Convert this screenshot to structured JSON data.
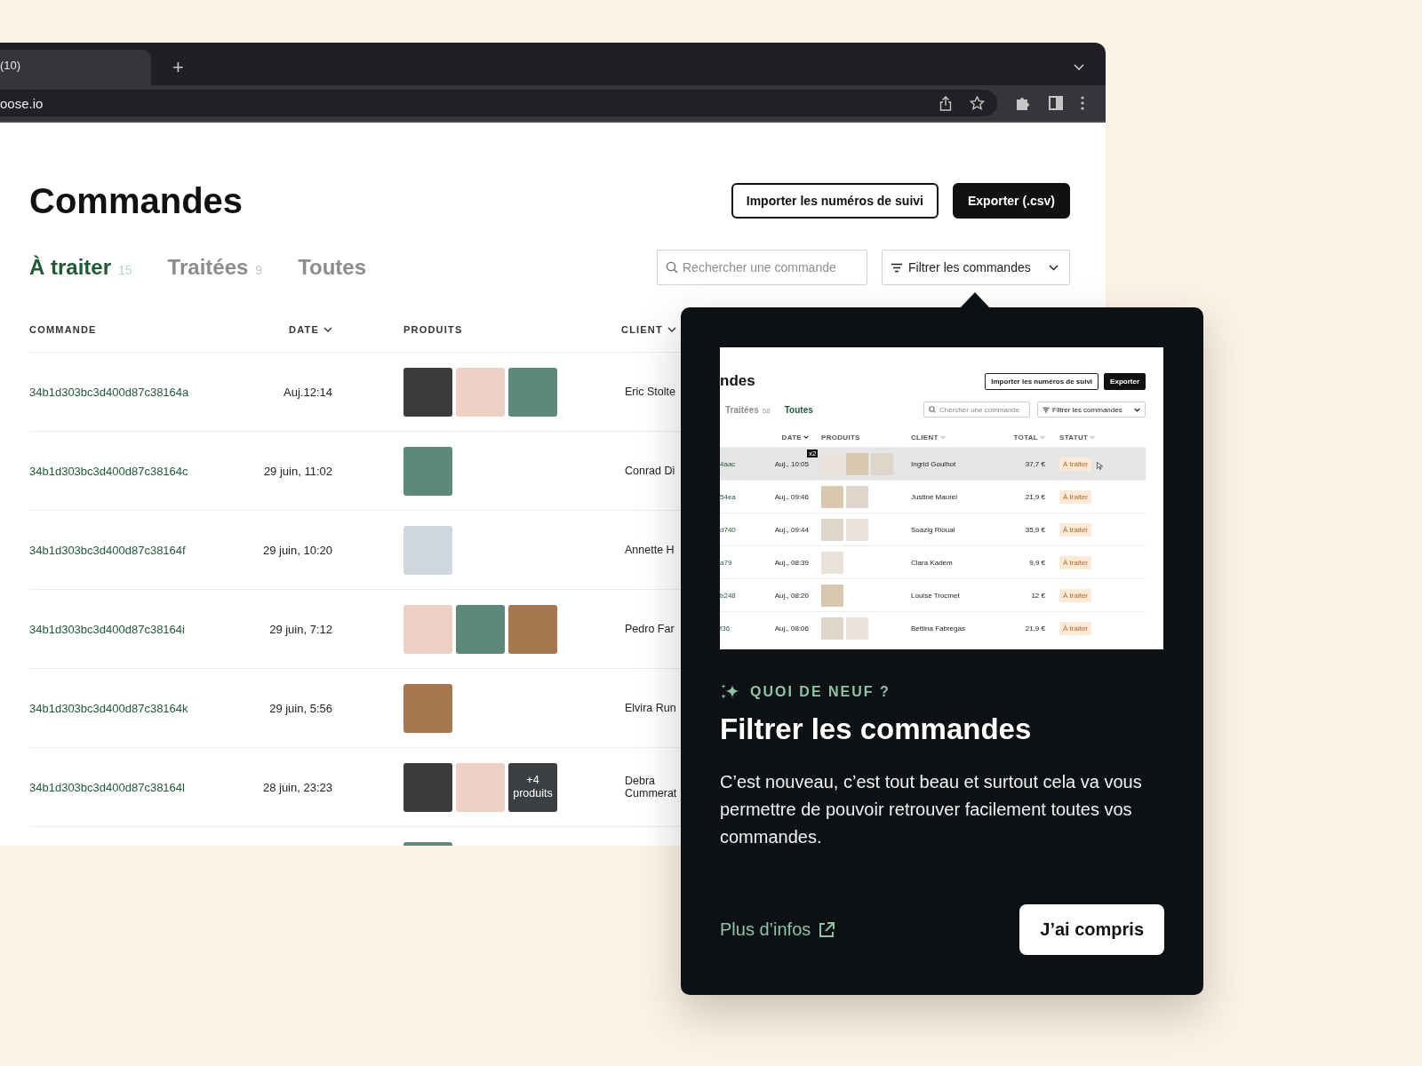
{
  "browser": {
    "tab_title": "(10)",
    "new_tab": "+",
    "address": "oose.io"
  },
  "page": {
    "title": "Commandes",
    "buttons": [
      {
        "label": "Importer les numéros de suivi",
        "kind": "outline"
      },
      {
        "label": "Exporter (.csv)",
        "kind": "primary"
      }
    ],
    "tabs": [
      {
        "label": "À traiter",
        "count": "15",
        "selected": true
      },
      {
        "label": "Traitées",
        "count": "9",
        "selected": false
      },
      {
        "label": "Toutes",
        "selected": false
      }
    ],
    "search": {
      "placeholder": "Rechercher une commande"
    },
    "filter": {
      "label": "Filtrer les commandes"
    },
    "table": {
      "columns": [
        {
          "label": "COMMANDE",
          "sortable": false
        },
        {
          "label": "DATE",
          "sortable": true
        },
        {
          "label": "PRODUITS",
          "sortable": false
        },
        {
          "label": "CLIENT",
          "sortable": true
        }
      ],
      "rows": [
        {
          "id": "34b1d303bc3d400d87c38164a",
          "date": "Auj.12:14",
          "products": [
            {
              "kind": "photo"
            },
            {
              "kind": "photo"
            },
            {
              "kind": "photo"
            }
          ],
          "client": "Eric Stolte"
        },
        {
          "id": "34b1d303bc3d400d87c38164c",
          "date": "29 juin, 11:02",
          "products": [
            {
              "kind": "photo"
            }
          ],
          "client": "Conrad Di"
        },
        {
          "id": "34b1d303bc3d400d87c38164f",
          "date": "29 juin, 10:20",
          "products": [
            {
              "kind": "photo"
            }
          ],
          "client": "Annette H"
        },
        {
          "id": "34b1d303bc3d400d87c38164i",
          "date": "29 juin, 7:12",
          "products": [
            {
              "kind": "photo"
            },
            {
              "kind": "photo"
            },
            {
              "kind": "photo"
            }
          ],
          "client": "Pedro Far"
        },
        {
          "id": "34b1d303bc3d400d87c38164k",
          "date": "29 juin, 5:56",
          "products": [
            {
              "kind": "photo"
            }
          ],
          "client": "Elvira Run"
        },
        {
          "id": "34b1d303bc3d400d87c38164l",
          "date": "28 juin, 23:23",
          "products": [
            {
              "kind": "photo"
            },
            {
              "kind": "photo"
            },
            {
              "kind": "more",
              "label": "+4 produits"
            }
          ],
          "client": "Debra Cummerat"
        },
        {
          "products": [
            {
              "kind": "photo"
            }
          ]
        }
      ]
    }
  },
  "popup": {
    "preview": {
      "title": "ndes",
      "buttons": [
        {
          "label": "Importer les numéros de suivi",
          "kind": "outline"
        },
        {
          "label": "Exporter",
          "kind": "primary"
        }
      ],
      "tabs": [
        {
          "label": "Traitées",
          "count": "58",
          "selected": false
        },
        {
          "label": "Toutes",
          "selected": true
        }
      ],
      "search": {
        "placeholder": "Chercher une commande"
      },
      "filter": {
        "label": "Filtrer les commandes"
      },
      "columns": [
        {
          "label": "DATE",
          "sortable": true
        },
        {
          "label": "PRODUITS",
          "sortable": false
        },
        {
          "label": "CLIENT",
          "sortable": true
        },
        {
          "label": "TOTAL",
          "sortable": true
        },
        {
          "label": "STATUT",
          "sortable": true
        }
      ],
      "rows": [
        {
          "id": "4aac",
          "date": "Auj., 10:05",
          "products": [
            {
              "kind": "photo",
              "badge": "x2"
            },
            {
              "kind": "photo"
            },
            {
              "kind": "photo"
            }
          ],
          "client": "Ingrid Goulhot",
          "total": "37,7 €",
          "status": "À traiter",
          "selected": true
        },
        {
          "id": "54ea",
          "date": "Auj., 09:46",
          "products": [
            {
              "kind": "photo"
            },
            {
              "kind": "photo"
            }
          ],
          "client": "Justine Maurel",
          "total": "21,9 €",
          "status": "À traiter",
          "selected": false
        },
        {
          "id": "d740",
          "date": "Auj., 09:44",
          "products": [
            {
              "kind": "photo"
            },
            {
              "kind": "photo"
            }
          ],
          "client": "Soazig Rioual",
          "total": "35,9 €",
          "status": "À traiter",
          "selected": false
        },
        {
          "id": "a79",
          "date": "Auj., 08:39",
          "products": [
            {
              "kind": "photo"
            }
          ],
          "client": "Clara Kadem",
          "total": "9,9 €",
          "status": "À traiter",
          "selected": false
        },
        {
          "id": "b248",
          "date": "Auj., 08:20",
          "products": [
            {
              "kind": "photo"
            }
          ],
          "client": "Louise Trocmet",
          "total": "12 €",
          "status": "À traiter",
          "selected": false
        },
        {
          "id": "f36",
          "date": "Auj., 08:06",
          "products": [
            {
              "kind": "photo"
            },
            {
              "kind": "photo"
            }
          ],
          "client": "Bettina Fabregas",
          "total": "21,9 €",
          "status": "À traiter",
          "selected": false
        }
      ]
    },
    "eyebrow": "QUOI DE NEUF ?",
    "title": "Filtrer les commandes",
    "body": "C’est nouveau, c’est tout beau et surtout cela va vous permettre de pouvoir retrouver facilement toutes vos commandes.",
    "link": "Plus d’infos",
    "button": "J’ai compris"
  }
}
